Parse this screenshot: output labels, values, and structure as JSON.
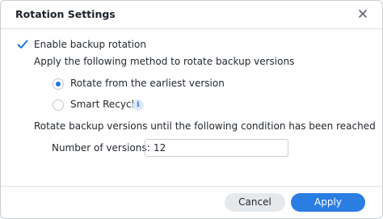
{
  "dialog": {
    "title": "Rotation Settings",
    "close_icon": "close-icon"
  },
  "rotation": {
    "enable_label": "Enable backup rotation",
    "enable_checked": true,
    "method_heading": "Apply the following method to rotate backup versions",
    "options": [
      {
        "label": "Rotate from the earliest version",
        "selected": true
      },
      {
        "label": "Smart Recycle",
        "selected": false,
        "info_icon": "info-icon"
      }
    ],
    "condition_heading": "Rotate backup versions until the following condition has been reached",
    "versions_label": "Number of versions:",
    "versions_value": "12"
  },
  "footer": {
    "cancel_label": "Cancel",
    "apply_label": "Apply"
  },
  "colors": {
    "accent": "#2a7de1",
    "check": "#1d74e0",
    "cancel_bg": "#e6e9ec"
  }
}
